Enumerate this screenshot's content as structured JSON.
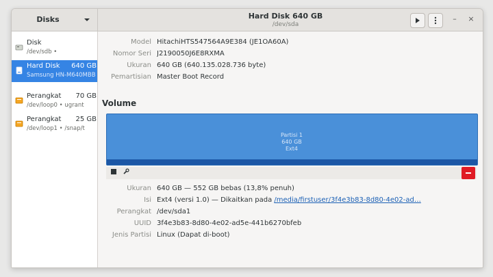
{
  "headerbar": {
    "sidebar_title": "Disks",
    "menu_icon": "caret-down-icon",
    "title": "Hard Disk 640 GB",
    "subtitle": "/dev/sda",
    "play_icon": "play-icon",
    "more_icon": "vertical-dots-icon",
    "minimize": "–",
    "close": "×"
  },
  "sidebar": {
    "devices": [
      {
        "name": "Disk",
        "size": "",
        "sub": "/dev/sdb  •  ",
        "icon": "drive-icon",
        "selected": false
      },
      {
        "name": "Hard Disk",
        "size": "640 GB",
        "sub": "Samsung HN-M640MBB",
        "icon": "hard-disk-icon",
        "selected": true
      },
      {
        "name": "Perangkat",
        "size": "70 GB",
        "sub": "/dev/loop0 • ugrant",
        "icon": "loop-device-icon",
        "selected": false
      },
      {
        "name": "Perangkat",
        "size": "25 GB",
        "sub": "/dev/loop1 • /snap/t",
        "icon": "loop-device-icon",
        "selected": false
      }
    ]
  },
  "disk_info": {
    "model_label": "Model",
    "model_value": "HitachiHTS547564A9E384 (JE1OA60A)",
    "serial_label": "Nomor Seri",
    "serial_value": "J2190050J6E8RXMA",
    "size_label": "Ukuran",
    "size_value": "640 GB (640.135.028.736 byte)",
    "partition_label": "Pemartisian",
    "partition_value": "Master Boot Record"
  },
  "volumes": {
    "section_title": "Volume",
    "map_label_line1": "Partisi 1",
    "map_label_line2": "640 GB",
    "map_label_line3": "Ext4",
    "stop_icon": "stop-icon",
    "settings_icon": "wrench-icon",
    "delete_icon": "minus-icon"
  },
  "volume_info": {
    "size_label": "Ukuran",
    "size_value": "640 GB — 552 GB bebas (13,8% penuh)",
    "contents_label": "Isi",
    "contents_value": "Ext4 (versi 1.0) — Dikaitkan pada ",
    "contents_link": "/media/firstuser/3f4e3b83-8d80-4e02-ad…",
    "device_label": "Perangkat",
    "device_value": "/dev/sda1",
    "uuid_label": "UUID",
    "uuid_value": "3f4e3b83-8d80-4e02-ad5e-441b6270bfeb",
    "ptype_label": "Jenis Partisi",
    "ptype_value": "Linux (Dapat di-boot)"
  }
}
